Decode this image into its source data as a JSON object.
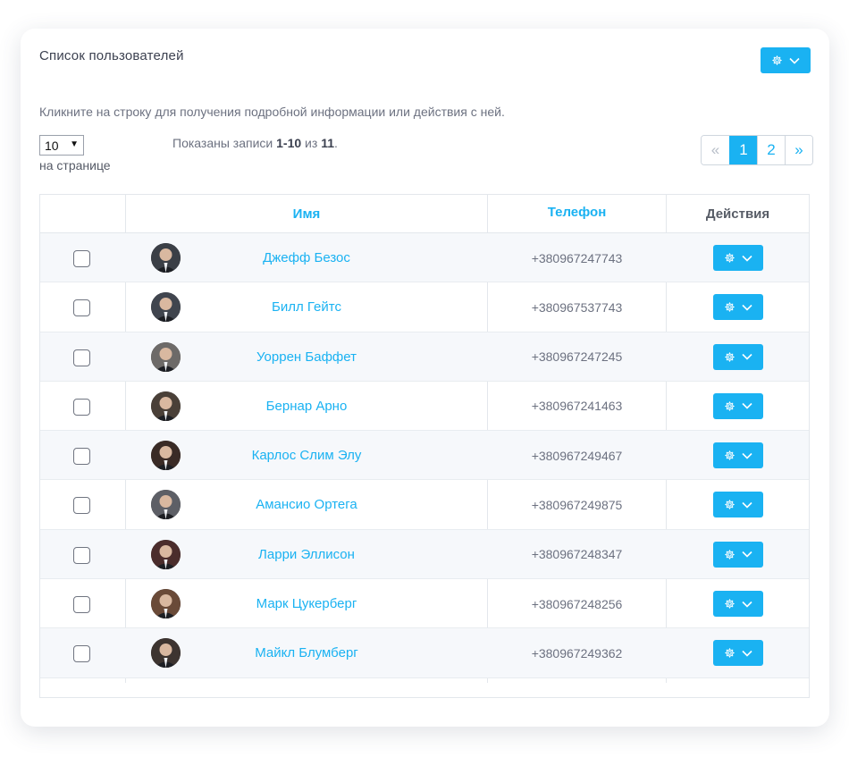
{
  "panel": {
    "title": "Список пользователей",
    "hint": "Кликните на строку для получения подробной информации или действия с ней."
  },
  "per_page": {
    "value": "10",
    "label": "на странице"
  },
  "records_info": {
    "prefix": "Показаны записи ",
    "range": "1-10",
    "middle": " из ",
    "total": "11",
    "suffix": "."
  },
  "pagination": {
    "prev": "«",
    "pages": [
      "1",
      "2"
    ],
    "active_page": "1",
    "next": "»"
  },
  "table": {
    "headers": {
      "name": "Имя",
      "phone": "Телефон",
      "actions": "Действия"
    },
    "rows": [
      {
        "name": "Джефф Безос",
        "phone": "+380967247743"
      },
      {
        "name": "Билл Гейтс",
        "phone": "+380967537743"
      },
      {
        "name": "Уоррен Баффет",
        "phone": "+380967247245"
      },
      {
        "name": "Бернар Арно",
        "phone": "+380967241463"
      },
      {
        "name": "Карлос Слим Элу",
        "phone": "+380967249467"
      },
      {
        "name": "Амансио Ортега",
        "phone": "+380967249875"
      },
      {
        "name": "Ларри Эллисон",
        "phone": "+380967248347"
      },
      {
        "name": "Марк Цукерберг",
        "phone": "+380967248256"
      },
      {
        "name": "Майкл Блумберг",
        "phone": "+380967249362"
      }
    ]
  },
  "colors": {
    "accent": "#1ab2f2",
    "text": "#3c4150",
    "muted": "#6c7180"
  },
  "icons": {
    "actions_button": "gear-icon",
    "dropdown": "chevron-down-icon",
    "select_arrow": "caret-down-icon"
  }
}
